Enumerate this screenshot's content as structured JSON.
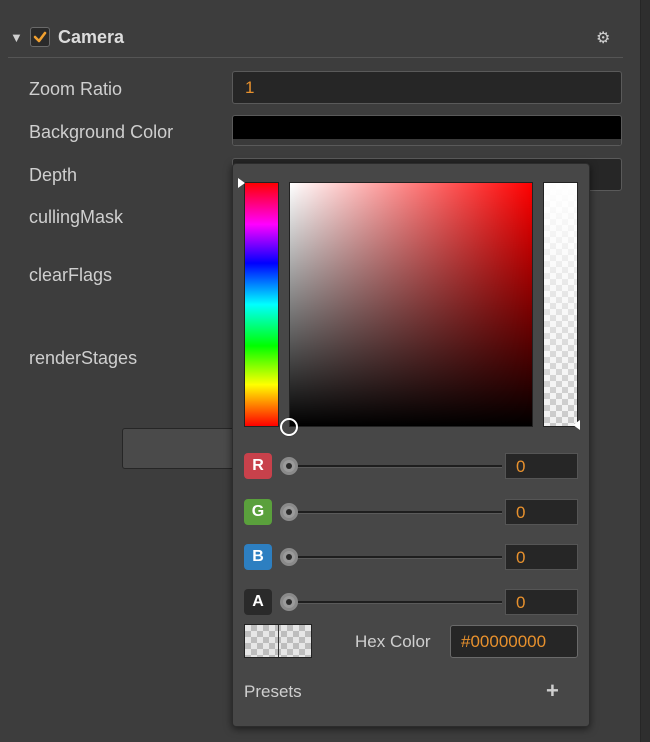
{
  "component": {
    "title": "Camera",
    "enabled": true,
    "collapse_icon": "triangle-down-icon",
    "settings_icon": "gear-icon"
  },
  "properties": {
    "zoom_ratio": {
      "label": "Zoom Ratio",
      "value": "1"
    },
    "background_color": {
      "label": "Background Color",
      "value": "#000000"
    },
    "depth": {
      "label": "Depth"
    },
    "culling_mask": {
      "label": "cullingMask"
    },
    "clear_flags": {
      "label": "clearFlags"
    },
    "render_stages": {
      "label": "renderStages"
    }
  },
  "color_picker": {
    "channels": [
      {
        "label": "R",
        "value": "0",
        "color": "#c8414b"
      },
      {
        "label": "G",
        "value": "0",
        "color": "#5aa03c"
      },
      {
        "label": "B",
        "value": "0",
        "color": "#2d7fc1"
      },
      {
        "label": "A",
        "value": "0",
        "color": "#2a2a2a"
      }
    ],
    "hex_label": "Hex Color",
    "hex_value": "#00000000",
    "presets_label": "Presets",
    "add_icon": "plus-icon"
  },
  "colors": {
    "accent": "#e8912d",
    "panel": "#3d3d3d",
    "popup": "#474747"
  }
}
